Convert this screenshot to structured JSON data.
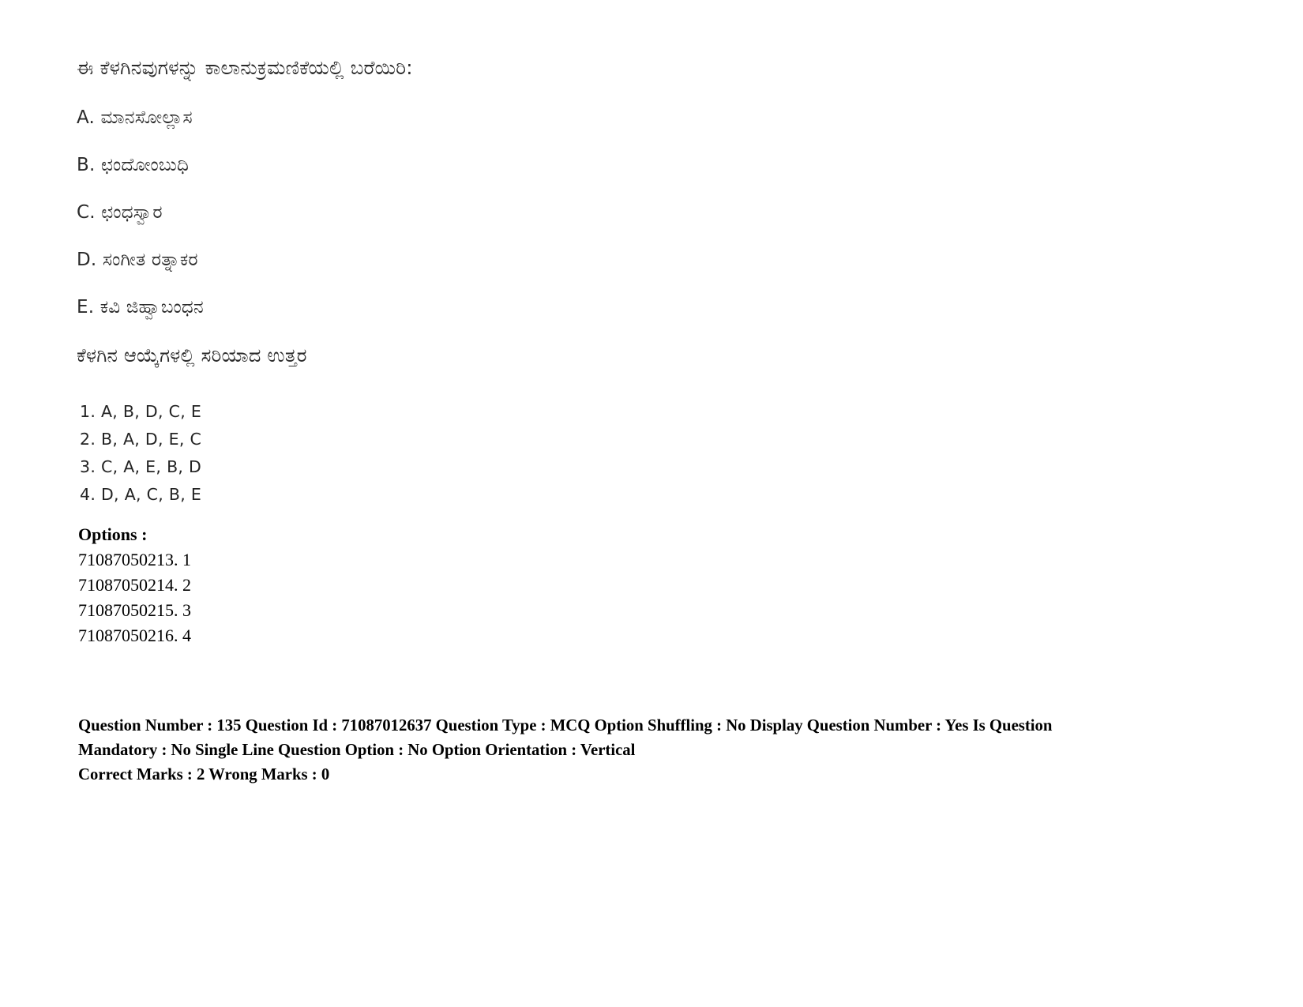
{
  "document": {
    "type": "exam-question-scan",
    "language": "Kannada"
  },
  "question": {
    "stem": "ಈ ಕೆಳಗಿನವುಗಳನ್ನು ಕಾಲಾನುಕ್ರಮಣಿಕೆಯಲ್ಲಿ ಬರೆಯಿರಿ:",
    "items": [
      "A. ಮಾನಸೋಲ್ಲಾಸ",
      "B. ಛಂದೋಂಬುಧಿ",
      "C. ಛಂಧಸ್ವಾರ",
      "D. ಸಂಗೀತ ರತ್ನಾಕರ",
      "E. ಕವಿ ಜಿಹ್ವಾಬಂಧನ"
    ],
    "prompt": "ಕೆಳಗಿನ ಆಯ್ಕೆಗಳಲ್ಲಿ ಸರಿಯಾದ ಉತ್ತರ",
    "choices": [
      "1. A, B, D, C, E",
      "2. B, A, D, E, C",
      "3. C, A, E, B, D",
      "4. D, A, C, B, E"
    ]
  },
  "options": {
    "heading": "Options :",
    "rows": [
      "71087050213. 1",
      "71087050214. 2",
      "71087050215. 3",
      "71087050216. 4"
    ]
  },
  "metadata": {
    "line1": "Question Number : 135 Question Id : 71087012637 Question Type : MCQ Option Shuffling : No Display Question Number : Yes Is Question Mandatory : No Single Line Question Option : No Option Orientation : Vertical",
    "line2": "Correct Marks : 2 Wrong Marks : 0",
    "fields": {
      "question_number": "135",
      "question_id": "71087012637",
      "question_type": "MCQ",
      "option_shuffling": "No",
      "display_question_number": "Yes",
      "is_question_mandatory": "No",
      "single_line_question_option": "No",
      "option_orientation": "Vertical",
      "correct_marks": "2",
      "wrong_marks": "0"
    }
  }
}
